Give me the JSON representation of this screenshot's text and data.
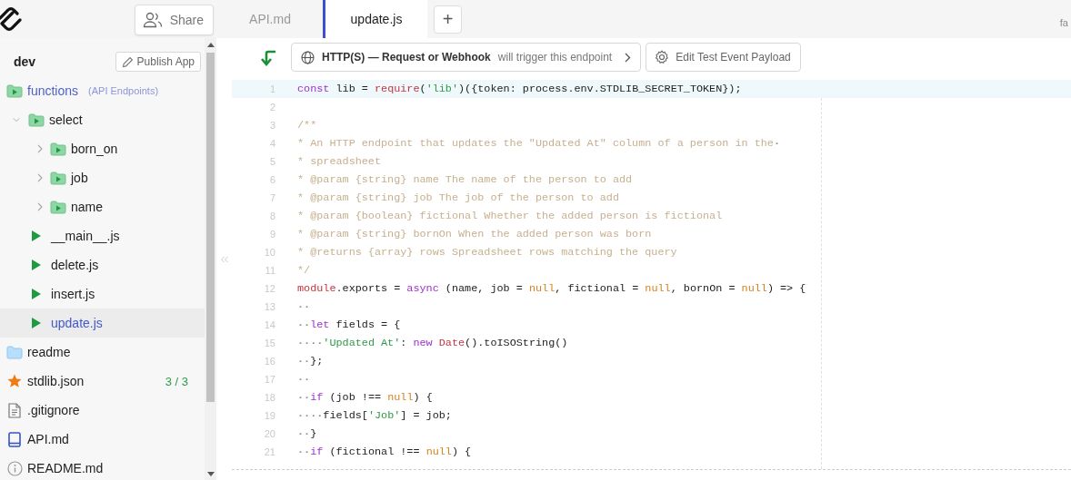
{
  "top_bar": {
    "share_button": "Share",
    "tabs": [
      {
        "label": "API.md",
        "selected": false
      },
      {
        "label": "update.js",
        "selected": true
      }
    ],
    "new_tab_button": "+",
    "corner_text": "fa"
  },
  "sidebar": {
    "environment": "dev",
    "publish_button": "Publish App",
    "tree": [
      {
        "name": "functions",
        "note": "(API Endpoints)",
        "kind": "endpoint-folder",
        "selected": false,
        "children": [
          {
            "name": "select",
            "kind": "endpoint-folder",
            "selected": false,
            "expanded": true,
            "children": [
              {
                "name": "born_on",
                "kind": "endpoint-folder",
                "selected": false,
                "expanded": false
              },
              {
                "name": "job",
                "kind": "endpoint-folder",
                "selected": false,
                "expanded": false
              },
              {
                "name": "name",
                "kind": "endpoint-folder",
                "selected": false,
                "expanded": false
              }
            ]
          },
          {
            "name": "__main__.js",
            "kind": "endpoint-file",
            "selected": false
          },
          {
            "name": "delete.js",
            "kind": "endpoint-file",
            "selected": false
          },
          {
            "name": "insert.js",
            "kind": "endpoint-file",
            "selected": false
          },
          {
            "name": "update.js",
            "kind": "endpoint-file",
            "selected": true
          }
        ]
      },
      {
        "name": "readme",
        "kind": "folder",
        "selected": false
      },
      {
        "name": "stdlib.json",
        "kind": "star-file",
        "selected": false,
        "badge": "3 / 3"
      },
      {
        "name": ".gitignore",
        "kind": "text-file",
        "selected": false
      },
      {
        "name": "API.md",
        "kind": "book-file",
        "selected": false
      },
      {
        "name": "README.md",
        "kind": "info-file",
        "selected": false
      }
    ]
  },
  "editor": {
    "trigger": {
      "label": "HTTP(S) — Request or Webhook",
      "suffix": "will trigger this endpoint"
    },
    "edit_payload_button": "Edit Test Event Payload",
    "lines": [
      {
        "number": "1",
        "highlighted": true,
        "tokens": [
          {
            "kind": "keyword",
            "text": "const"
          },
          {
            "kind": "plain",
            "text": " lib = "
          },
          {
            "kind": "builtin",
            "text": "require"
          },
          {
            "kind": "plain",
            "text": "("
          },
          {
            "kind": "string",
            "text": "'lib'"
          },
          {
            "kind": "plain",
            "text": ")({token: process.env.STDLIB_SECRET_TOKEN});"
          }
        ]
      },
      {
        "number": "2",
        "highlighted": false
      },
      {
        "number": "3",
        "highlighted": false,
        "tokens": [
          {
            "kind": "comment",
            "text": "/**"
          }
        ]
      },
      {
        "number": "4",
        "highlighted": false,
        "tokens": [
          {
            "kind": "comment",
            "text": "* An HTTP endpoint that updates the \"Updated At\" column of a person in the"
          },
          {
            "kind": "space",
            "text": "·"
          }
        ]
      },
      {
        "number": "5",
        "highlighted": false,
        "tokens": [
          {
            "kind": "comment",
            "text": "* spreadsheet"
          }
        ]
      },
      {
        "number": "6",
        "highlighted": false,
        "tokens": [
          {
            "kind": "comment",
            "text": "* @param {string} name The name of the person to add"
          }
        ]
      },
      {
        "number": "7",
        "highlighted": false,
        "tokens": [
          {
            "kind": "comment",
            "text": "* @param {string} job The job of the person to add"
          }
        ]
      },
      {
        "number": "8",
        "highlighted": false,
        "tokens": [
          {
            "kind": "comment",
            "text": "* @param {boolean} fictional Whether the added person is fictional"
          }
        ]
      },
      {
        "number": "9",
        "highlighted": false,
        "tokens": [
          {
            "kind": "comment",
            "text": "* @param {string} bornOn When the added person was born"
          }
        ]
      },
      {
        "number": "10",
        "highlighted": false,
        "tokens": [
          {
            "kind": "comment",
            "text": "* @returns {array} rows Spreadsheet rows matching the query"
          }
        ]
      },
      {
        "number": "11",
        "highlighted": false,
        "tokens": [
          {
            "kind": "comment",
            "text": "*/"
          }
        ]
      },
      {
        "number": "12",
        "highlighted": false,
        "tokens": [
          {
            "kind": "builtin",
            "text": "module"
          },
          {
            "kind": "plain",
            "text": ".exports = "
          },
          {
            "kind": "keyword",
            "text": "async"
          },
          {
            "kind": "plain",
            "text": " (name, job = "
          },
          {
            "kind": "literal",
            "text": "null"
          },
          {
            "kind": "plain",
            "text": ", fictional = "
          },
          {
            "kind": "literal",
            "text": "null"
          },
          {
            "kind": "plain",
            "text": ", bornOn = "
          },
          {
            "kind": "literal",
            "text": "null"
          },
          {
            "kind": "plain",
            "text": ") => {"
          }
        ]
      },
      {
        "number": "13",
        "highlighted": false,
        "tokens": [
          {
            "kind": "space",
            "text": "··"
          }
        ]
      },
      {
        "number": "14",
        "highlighted": false,
        "tokens": [
          {
            "kind": "space",
            "text": "··"
          },
          {
            "kind": "keyword",
            "text": "let"
          },
          {
            "kind": "plain",
            "text": " fields = {"
          }
        ]
      },
      {
        "number": "15",
        "highlighted": false,
        "tokens": [
          {
            "kind": "space",
            "text": "····"
          },
          {
            "kind": "string",
            "text": "'Updated At'"
          },
          {
            "kind": "plain",
            "text": ": "
          },
          {
            "kind": "keyword",
            "text": "new"
          },
          {
            "kind": "builtin",
            "text": " Date"
          },
          {
            "kind": "plain",
            "text": "().toISOString()"
          }
        ]
      },
      {
        "number": "16",
        "highlighted": false,
        "tokens": [
          {
            "kind": "space",
            "text": "··"
          },
          {
            "kind": "plain",
            "text": "};"
          }
        ]
      },
      {
        "number": "17",
        "highlighted": false,
        "tokens": [
          {
            "kind": "space",
            "text": "··"
          }
        ]
      },
      {
        "number": "18",
        "highlighted": false,
        "tokens": [
          {
            "kind": "space",
            "text": "··"
          },
          {
            "kind": "keyword",
            "text": "if"
          },
          {
            "kind": "plain",
            "text": " (job !== "
          },
          {
            "kind": "literal",
            "text": "null"
          },
          {
            "kind": "plain",
            "text": ") {"
          }
        ]
      },
      {
        "number": "19",
        "highlighted": false,
        "tokens": [
          {
            "kind": "space",
            "text": "····"
          },
          {
            "kind": "plain",
            "text": "fields["
          },
          {
            "kind": "string",
            "text": "'Job'"
          },
          {
            "kind": "plain",
            "text": "] = job;"
          }
        ]
      },
      {
        "number": "20",
        "highlighted": false,
        "tokens": [
          {
            "kind": "space",
            "text": "··"
          },
          {
            "kind": "plain",
            "text": "}"
          }
        ]
      },
      {
        "number": "21",
        "highlighted": false,
        "tokens": [
          {
            "kind": "space",
            "text": "··"
          },
          {
            "kind": "keyword",
            "text": "if"
          },
          {
            "kind": "plain",
            "text": " (fictional !== "
          },
          {
            "kind": "literal",
            "text": "null"
          },
          {
            "kind": "plain",
            "text": ") {"
          }
        ]
      }
    ]
  }
}
